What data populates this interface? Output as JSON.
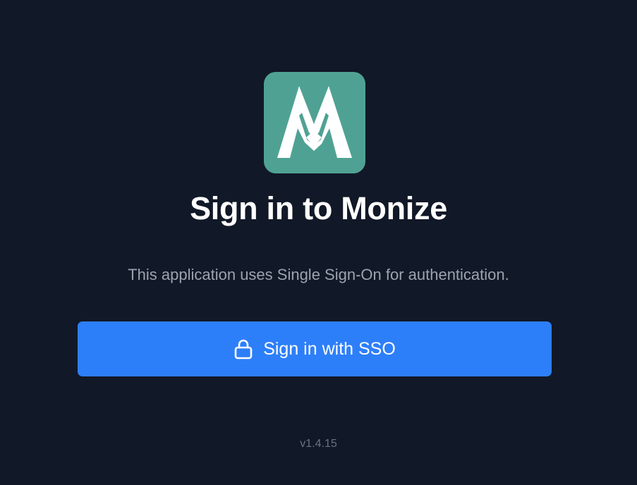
{
  "app": {
    "logo": {
      "icon": "monize-m-logo",
      "letter": "M",
      "background_color": "#4fa293"
    },
    "title": "Sign in to Monize",
    "subtitle": "This application uses Single Sign-On for authentication."
  },
  "sso_button": {
    "label": "Sign in with SSO",
    "icon": "lock-icon",
    "color": "#2d7ff9"
  },
  "footer": {
    "version": "v1.4.15"
  },
  "colors": {
    "background": "#111827",
    "title_text": "#ffffff",
    "subtitle_text": "#9ca3af",
    "version_text": "#6b7280"
  }
}
